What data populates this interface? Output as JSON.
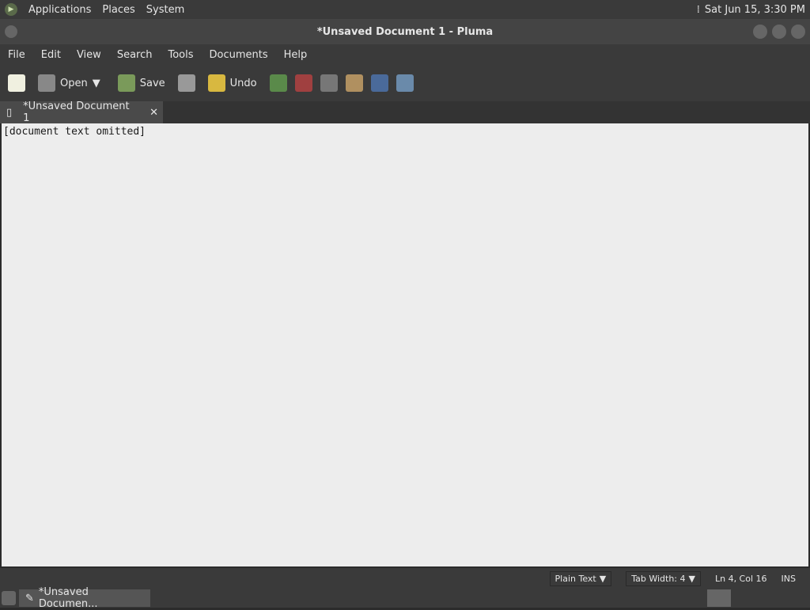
{
  "top_panel": {
    "menu": [
      "Applications",
      "Places",
      "System"
    ],
    "clock": "Sat Jun 15,  3:30 PM"
  },
  "window": {
    "title": "*Unsaved Document 1 - Pluma"
  },
  "menubar": [
    "File",
    "Edit",
    "View",
    "Search",
    "Tools",
    "Documents",
    "Help"
  ],
  "toolbar": {
    "new_icon": "new-document-icon",
    "open_label": "Open",
    "save_label": "Save",
    "print_icon": "print-icon",
    "undo_label": "Undo",
    "redo_icon": "redo-icon",
    "cut_icon": "cut-icon",
    "copy_icon": "copy-icon",
    "paste_icon": "paste-icon",
    "find_icon": "find-icon",
    "replace_icon": "replace-icon"
  },
  "tab": {
    "label": "*Unsaved Document 1",
    "close": "✕"
  },
  "editor": {
    "content_note": "[document text omitted]"
  },
  "statusbar": {
    "language": "Plain Text",
    "tab_width": "Tab Width:  4",
    "position": "Ln 4, Col 16",
    "mode": "INS"
  },
  "bottom_panel": {
    "task_label": "*Unsaved Documen..."
  }
}
